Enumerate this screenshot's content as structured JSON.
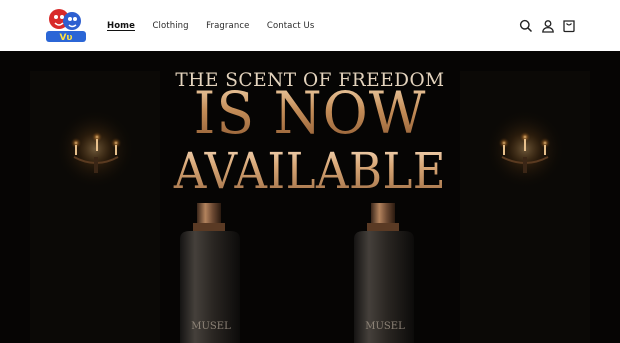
{
  "header": {
    "logo_name": "Voyeur brand logo",
    "nav": [
      {
        "label": "Home",
        "active": true
      },
      {
        "label": "Clothing",
        "active": false
      },
      {
        "label": "Fragrance",
        "active": false
      },
      {
        "label": "Contact Us",
        "active": false
      }
    ],
    "icons": [
      "search-icon",
      "account-icon",
      "cart-icon"
    ]
  },
  "hero": {
    "line1": "THE SCENT OF FREEDOM",
    "line2": "IS NOW",
    "line3": "AVAILABLE",
    "bottle_label_left": "MUSEL",
    "bottle_label_right": "MUSEL"
  },
  "colors": {
    "header_bg": "#ffffff",
    "hero_bg": "#070504",
    "gold": "#c48d58",
    "cream": "#e3d3bd"
  }
}
